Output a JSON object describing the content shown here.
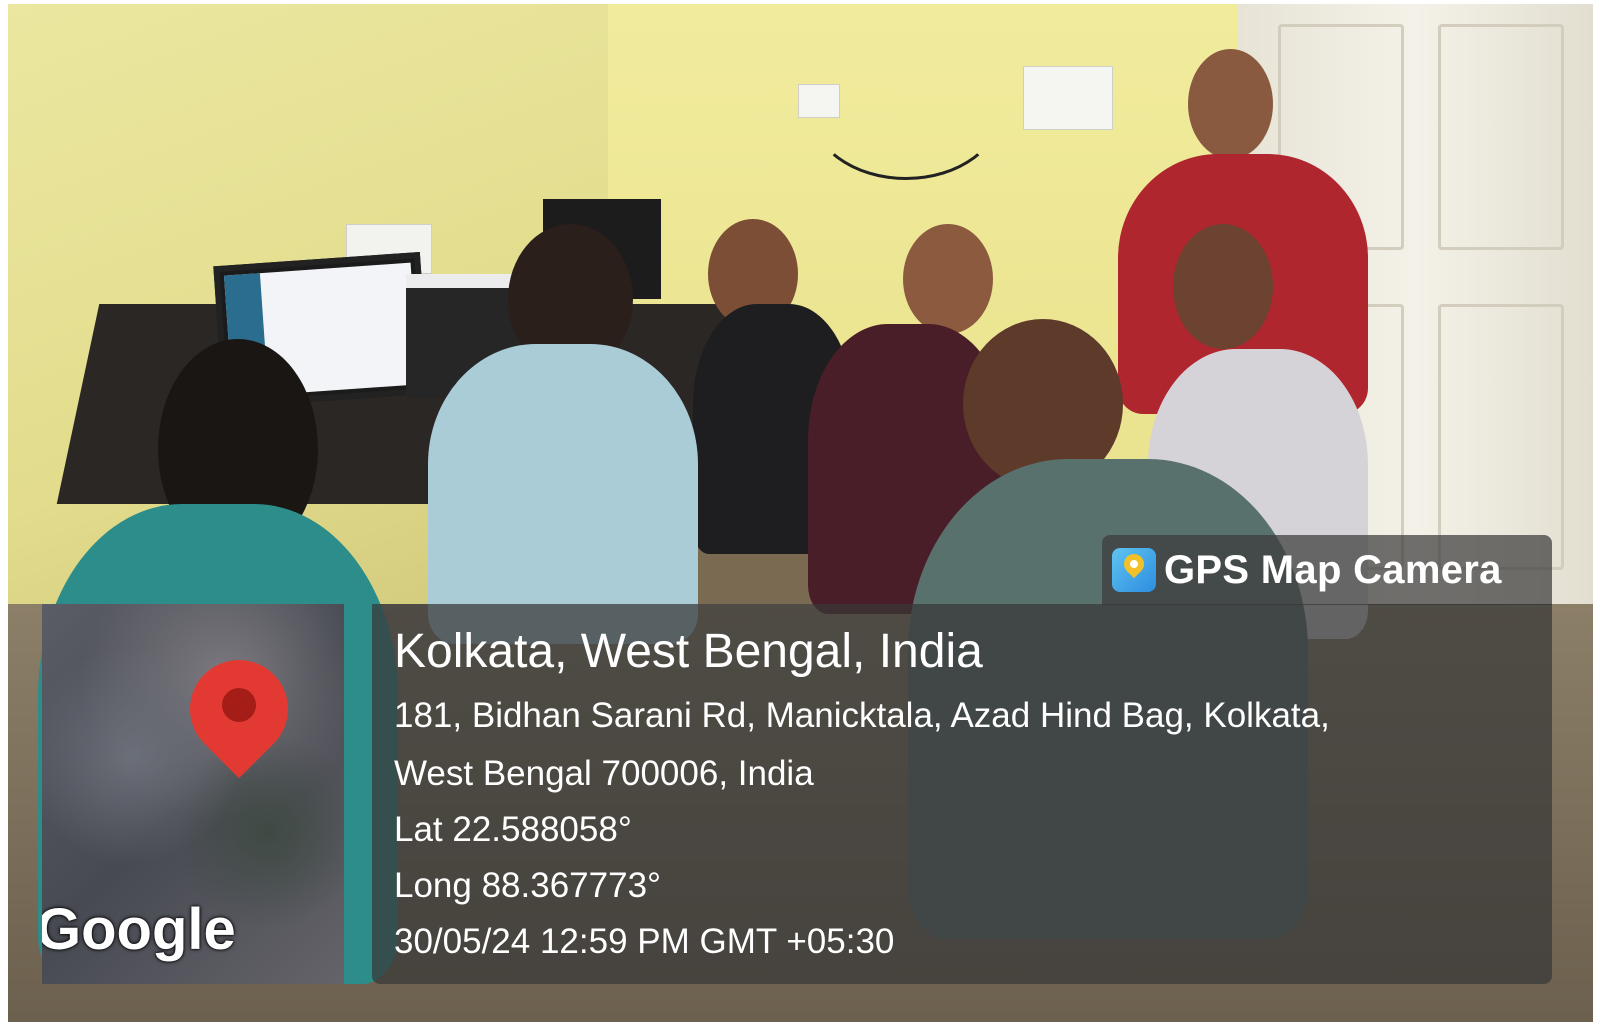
{
  "overlay": {
    "app_name": "GPS Map Camera",
    "app_icon": "gps-map-camera-icon",
    "location_title": "Kolkata, West Bengal, India",
    "address_line1": "181, Bidhan Sarani Rd, Manicktala, Azad Hind Bag, Kolkata,",
    "address_line2": "West Bengal 700006, India",
    "latitude": "Lat 22.588058°",
    "longitude": "Long 88.367773°",
    "datetime": "30/05/24 12:59 PM GMT +05:30"
  },
  "map": {
    "brand": "Google",
    "marker_icon": "map-pin-icon",
    "marker_color": "#e23a32"
  },
  "colors": {
    "overlay_bg": "#373737",
    "text": "#ffffff",
    "wall": "#e9e28e"
  }
}
